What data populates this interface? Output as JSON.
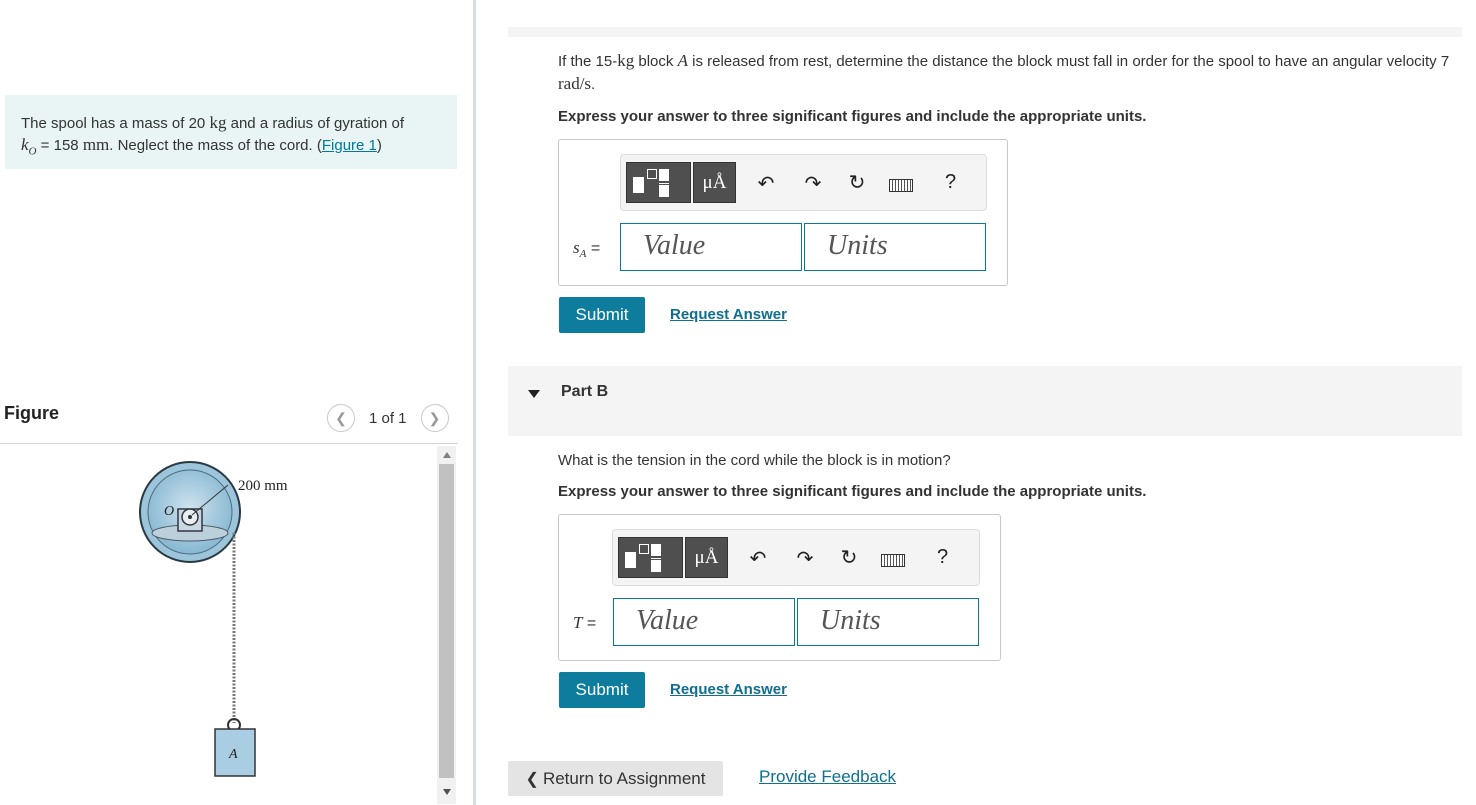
{
  "problem": {
    "text_before_mass": "The spool has a mass of 20",
    "mass_unit": "kg",
    "text_after_mass": "and a radius of gyration of",
    "k_symbol": "k",
    "k_subscript": "O",
    "k_eq": "= 158",
    "k_unit": "mm",
    "text_after_k": ". Neglect the mass of the cord. (",
    "figure_link": "Figure 1",
    "close_paren": ")"
  },
  "figure_panel": {
    "title": "Figure",
    "prev_icon": "chevron-left-icon",
    "next_icon": "chevron-right-icon",
    "pager_text": "1 of 1",
    "diagram": {
      "radius_label": "200 mm",
      "center_label": "O",
      "block_label": "A"
    }
  },
  "part_a": {
    "question_pre": "If the 15-",
    "question_mass_unit": "kg",
    "question_mid": " block ",
    "question_block": "A",
    "question_post": " is released from rest, determine the distance the block must fall in order for the spool to have an angular velocity 7 ",
    "question_w_unit": "rad/s",
    "question_end": ".",
    "instruction": "Express your answer to three significant figures and include the appropriate units.",
    "variable": "s",
    "variable_sub": "A",
    "equals": "=",
    "value_placeholder": "Value",
    "units_placeholder": "Units",
    "submit_label": "Submit",
    "request_label": "Request Answer"
  },
  "part_b": {
    "label": "Part B",
    "question": "What is the tension in the cord while the block is in motion?",
    "instruction": "Express your answer to three significant figures and include the appropriate units.",
    "variable": "T",
    "equals": "=",
    "value_placeholder": "Value",
    "units_placeholder": "Units",
    "submit_label": "Submit",
    "request_label": "Request Answer"
  },
  "toolbar": {
    "units_button": "μÅ",
    "help": "?",
    "icons": [
      "templates-icon",
      "units-icon",
      "undo-icon",
      "redo-icon",
      "reset-icon",
      "keyboard-icon",
      "help-icon"
    ]
  },
  "footer": {
    "return_label": "Return to Assignment",
    "feedback_label": "Provide Feedback"
  },
  "colors": {
    "accent": "#0e7c9c",
    "intro_bg": "#e9f4f4",
    "field_border": "#0b7a99"
  }
}
